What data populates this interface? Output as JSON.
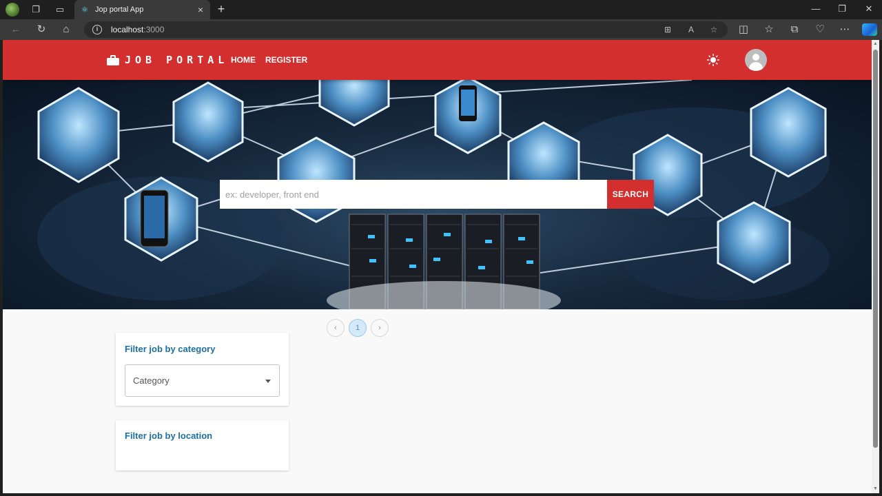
{
  "browser": {
    "tab_title": "Jop portal App",
    "url_host": "localhost",
    "url_port": ":3000"
  },
  "app": {
    "brand": "JOB PORTAL",
    "nav": {
      "home": "HOME",
      "register": "REGISTER"
    },
    "accent_color": "#d32f2f"
  },
  "search": {
    "placeholder": "ex: developer, front end",
    "button_label": "SEARCH"
  },
  "pagination": {
    "prev": "‹",
    "current": "1",
    "next": "›"
  },
  "filters": {
    "category": {
      "title": "Filter job by category",
      "select_label": "Category"
    },
    "location": {
      "title": "Filter job by location"
    }
  }
}
